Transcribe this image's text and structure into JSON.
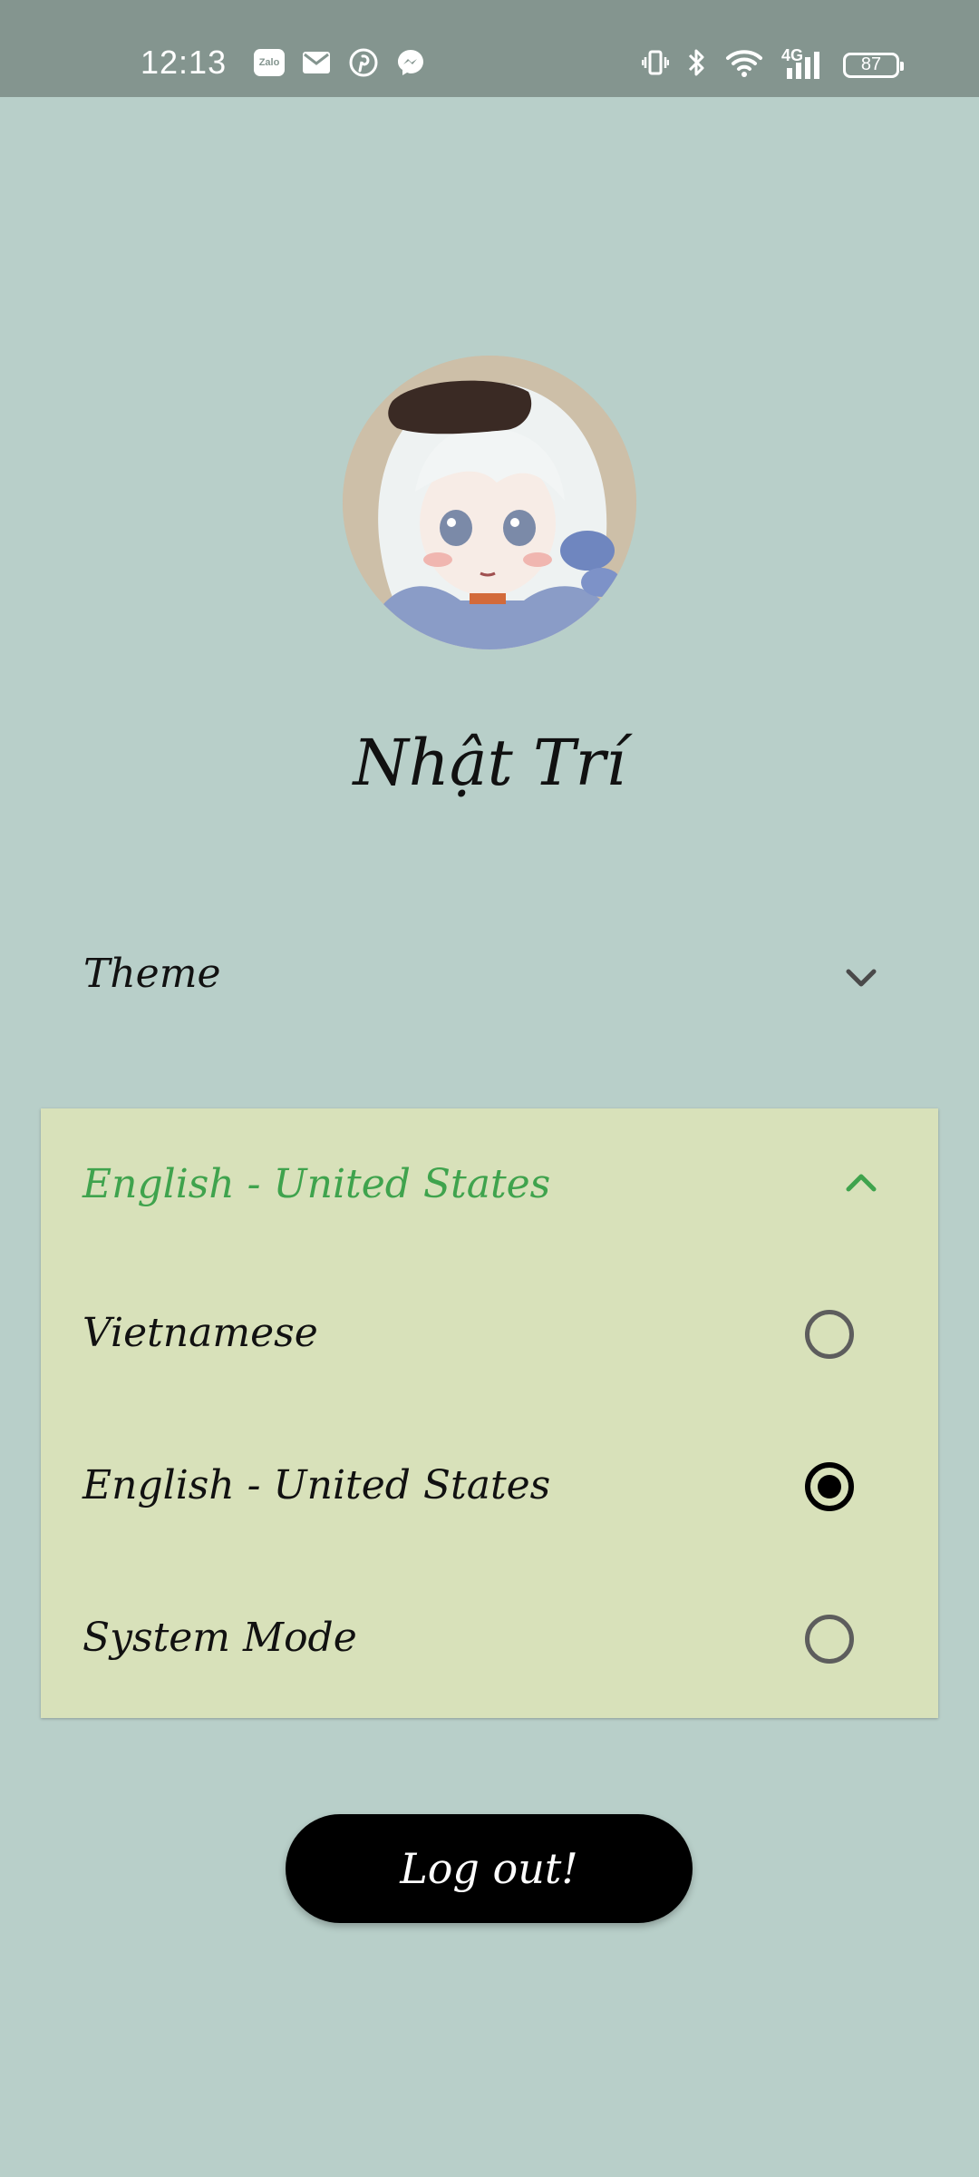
{
  "status_bar": {
    "time": "12:13",
    "notification_icons": [
      "zalo-icon",
      "mail-icon",
      "pinterest-icon",
      "messenger-icon"
    ],
    "zalo_text": "Zalo",
    "network_label": "4G",
    "battery": "87"
  },
  "profile": {
    "name": "Nhật Trí"
  },
  "settings": {
    "theme": {
      "label": "Theme",
      "expanded": false
    },
    "language": {
      "selected_label": "English - United States",
      "expanded": true,
      "options": [
        {
          "label": "Vietnamese",
          "selected": false
        },
        {
          "label": "English - United States",
          "selected": true
        },
        {
          "label": "System Mode",
          "selected": false
        }
      ]
    }
  },
  "actions": {
    "logout_label": "Log out!"
  },
  "colors": {
    "background": "#b8cfc9",
    "status_bar": "#84958f",
    "panel": "#d8e1ba",
    "accent": "#3fa34d",
    "button": "#000000"
  }
}
